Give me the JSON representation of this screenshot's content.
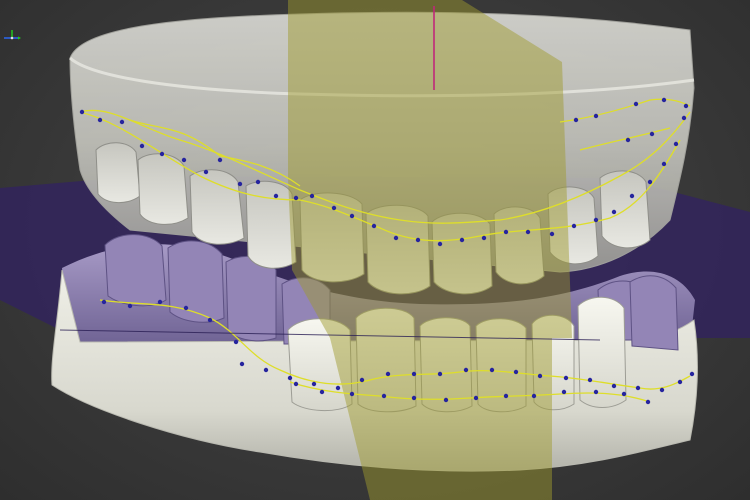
{
  "viewport": {
    "label": "",
    "view_mode": "3D perspective",
    "background_color": "#3a3a3a"
  },
  "models": {
    "upper_jaw": {
      "material": "translucent",
      "color": "#c9c9c2"
    },
    "lower_jaw": {
      "material": "opaque",
      "color": "#e3e3da",
      "gingiva_color": "#8f82b0"
    }
  },
  "overlays": {
    "sagittal_plane_color": "#a7a230",
    "occlusal_plane_color": "#3b2a6e",
    "margin_line_color": "#dede2a",
    "margin_point_color": "#26249e",
    "vertical_axis_color": "#c0287a"
  },
  "gizmo": {
    "x_axis_color": "#2a6bff",
    "y_axis_color": "#1fd01f",
    "icon": "axis-gizmo-icon"
  }
}
